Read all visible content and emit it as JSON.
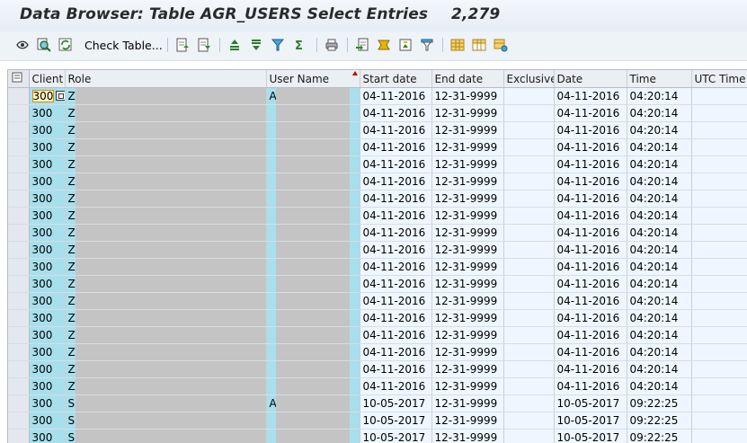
{
  "window": {
    "title": "Data Browser: Table AGR_USERS Select Entries",
    "entry_count": "2,279"
  },
  "toolbar": {
    "check_table_label": "Check Table...",
    "icons": [
      "details-icon",
      "search-icon",
      "refresh-icon",
      "first-page-icon",
      "last-page-icon",
      "sort-ascending-icon",
      "sort-descending-icon",
      "filter-icon",
      "total-icon",
      "print-icon",
      "export-icon",
      "calculator-icon",
      "graphic-icon",
      "layout-icon",
      "grid-icon",
      "columns-icon",
      "settings-icon"
    ]
  },
  "columns": [
    "Client",
    "Role",
    "User Name",
    "Start date",
    "End date",
    "Exclusive",
    "Date",
    "Time",
    "UTC Time S"
  ],
  "rows": [
    {
      "client": "300",
      "role": "Z",
      "user": "A",
      "start": "04-11-2016",
      "end": "12-31-9999",
      "exclusive": "",
      "date": "04-11-2016",
      "time": "04:20:14"
    },
    {
      "client": "300",
      "role": "Z",
      "user": "",
      "start": "04-11-2016",
      "end": "12-31-9999",
      "exclusive": "",
      "date": "04-11-2016",
      "time": "04:20:14"
    },
    {
      "client": "300",
      "role": "Z",
      "user": "",
      "start": "04-11-2016",
      "end": "12-31-9999",
      "exclusive": "",
      "date": "04-11-2016",
      "time": "04:20:14"
    },
    {
      "client": "300",
      "role": "Z",
      "user": "",
      "start": "04-11-2016",
      "end": "12-31-9999",
      "exclusive": "",
      "date": "04-11-2016",
      "time": "04:20:14"
    },
    {
      "client": "300",
      "role": "Z",
      "user": "",
      "start": "04-11-2016",
      "end": "12-31-9999",
      "exclusive": "",
      "date": "04-11-2016",
      "time": "04:20:14"
    },
    {
      "client": "300",
      "role": "Z",
      "user": "",
      "start": "04-11-2016",
      "end": "12-31-9999",
      "exclusive": "",
      "date": "04-11-2016",
      "time": "04:20:14"
    },
    {
      "client": "300",
      "role": "Z",
      "user": "",
      "start": "04-11-2016",
      "end": "12-31-9999",
      "exclusive": "",
      "date": "04-11-2016",
      "time": "04:20:14"
    },
    {
      "client": "300",
      "role": "Z",
      "user": "",
      "start": "04-11-2016",
      "end": "12-31-9999",
      "exclusive": "",
      "date": "04-11-2016",
      "time": "04:20:14"
    },
    {
      "client": "300",
      "role": "Z",
      "user": "",
      "start": "04-11-2016",
      "end": "12-31-9999",
      "exclusive": "",
      "date": "04-11-2016",
      "time": "04:20:14"
    },
    {
      "client": "300",
      "role": "Z",
      "user": "",
      "start": "04-11-2016",
      "end": "12-31-9999",
      "exclusive": "",
      "date": "04-11-2016",
      "time": "04:20:14"
    },
    {
      "client": "300",
      "role": "Z",
      "user": "",
      "start": "04-11-2016",
      "end": "12-31-9999",
      "exclusive": "",
      "date": "04-11-2016",
      "time": "04:20:14"
    },
    {
      "client": "300",
      "role": "Z",
      "user": "",
      "start": "04-11-2016",
      "end": "12-31-9999",
      "exclusive": "",
      "date": "04-11-2016",
      "time": "04:20:14"
    },
    {
      "client": "300",
      "role": "Z",
      "user": "",
      "start": "04-11-2016",
      "end": "12-31-9999",
      "exclusive": "",
      "date": "04-11-2016",
      "time": "04:20:14"
    },
    {
      "client": "300",
      "role": "Z",
      "user": "",
      "start": "04-11-2016",
      "end": "12-31-9999",
      "exclusive": "",
      "date": "04-11-2016",
      "time": "04:20:14"
    },
    {
      "client": "300",
      "role": "Z",
      "user": "",
      "start": "04-11-2016",
      "end": "12-31-9999",
      "exclusive": "",
      "date": "04-11-2016",
      "time": "04:20:14"
    },
    {
      "client": "300",
      "role": "Z",
      "user": "",
      "start": "04-11-2016",
      "end": "12-31-9999",
      "exclusive": "",
      "date": "04-11-2016",
      "time": "04:20:14"
    },
    {
      "client": "300",
      "role": "Z",
      "user": "",
      "start": "04-11-2016",
      "end": "12-31-9999",
      "exclusive": "",
      "date": "04-11-2016",
      "time": "04:20:14"
    },
    {
      "client": "300",
      "role": "Z",
      "user": "",
      "start": "04-11-2016",
      "end": "12-31-9999",
      "exclusive": "",
      "date": "04-11-2016",
      "time": "04:20:14"
    },
    {
      "client": "300",
      "role": "S",
      "user": "A",
      "start": "10-05-2017",
      "end": "12-31-9999",
      "exclusive": "",
      "date": "10-05-2017",
      "time": "09:22:25"
    },
    {
      "client": "300",
      "role": "S",
      "user": "",
      "start": "10-05-2017",
      "end": "12-31-9999",
      "exclusive": "",
      "date": "10-05-2017",
      "time": "09:22:25"
    },
    {
      "client": "300",
      "role": "S",
      "user": "",
      "start": "10-05-2017",
      "end": "12-31-9999",
      "exclusive": "",
      "date": "10-05-2017",
      "time": "09:22:25"
    }
  ],
  "colors": {
    "key_column": "#a8dfec",
    "data_column": "#eef7ff",
    "redacted": "#c4c4c4",
    "header": "#ebeef2"
  }
}
